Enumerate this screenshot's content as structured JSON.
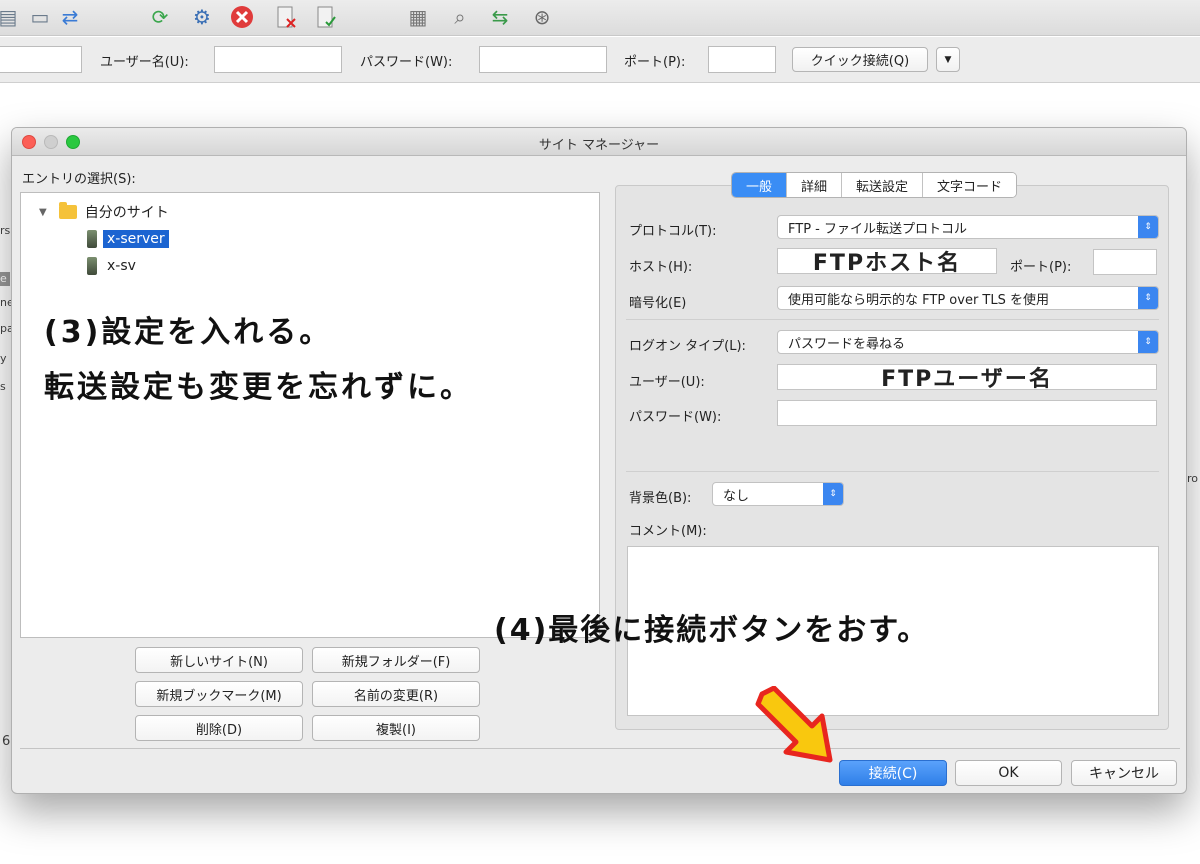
{
  "toolbar": {
    "icons": [
      "site-manager-icon",
      "toggle-panels-icon",
      "transfer-icon",
      "refresh-icon",
      "filter-icon",
      "cancel-icon",
      "disconnect-icon",
      "reconnect-icon",
      "directory-listing-icon",
      "search-icon",
      "sync-icon",
      "find-icon"
    ]
  },
  "quickbar": {
    "user_label": "ユーザー名(U):",
    "password_label": "パスワード(W):",
    "port_label": "ポート(P):",
    "quick_connect": "クイック接続(Q)",
    "dropdown_arrow": "▼"
  },
  "background_fragments": [
    "rs",
    "e",
    "ne",
    "pa",
    "y",
    "s",
    "6",
    "ro"
  ],
  "dialog": {
    "title": "サイト マネージャー",
    "entry_label": "エントリの選択(S):",
    "tree": {
      "folder": "自分のサイト",
      "sites": [
        "x-server",
        "x-sv"
      ],
      "expand_glyph": "▼"
    },
    "left_buttons": {
      "new_site": "新しいサイト(N)",
      "new_folder": "新規フォルダー(F)",
      "new_bookmark": "新規ブックマーク(M)",
      "rename": "名前の変更(R)",
      "delete": "削除(D)",
      "duplicate": "複製(I)"
    },
    "tabs": [
      "一般",
      "詳細",
      "転送設定",
      "文字コード"
    ],
    "active_tab": "一般",
    "form": {
      "protocol_label": "プロトコル(T):",
      "protocol_value": "FTP - ファイル転送プロトコル",
      "host_label": "ホスト(H):",
      "host_value": "FTPホスト名",
      "port_label": "ポート(P):",
      "port_value": "",
      "encryption_label": "暗号化(E)",
      "encryption_value": "使用可能なら明示的な FTP over TLS を使用",
      "logon_label": "ログオン タイプ(L):",
      "logon_value": "パスワードを尋ねる",
      "user_label": "ユーザー(U):",
      "user_value": "FTPユーザー名",
      "password_label": "パスワード(W):",
      "password_value": "",
      "bgcolor_label": "背景色(B):",
      "bgcolor_value": "なし",
      "comment_label": "コメント(M):",
      "select_arrow": "⇕"
    },
    "bottom_buttons": {
      "connect": "接続(C)",
      "ok": "OK",
      "cancel": "キャンセル"
    }
  },
  "annotations": {
    "step3_line1": "(3)設定を入れる。",
    "step3_line2": "転送設定も変更を忘れずに。",
    "step4": "(4)最後に接続ボタンをおす。"
  },
  "colors": {
    "accent": "#3a8df5",
    "selection": "#1b64d1",
    "arrow_fill": "#f9c80e",
    "arrow_stroke": "#e8261f"
  }
}
